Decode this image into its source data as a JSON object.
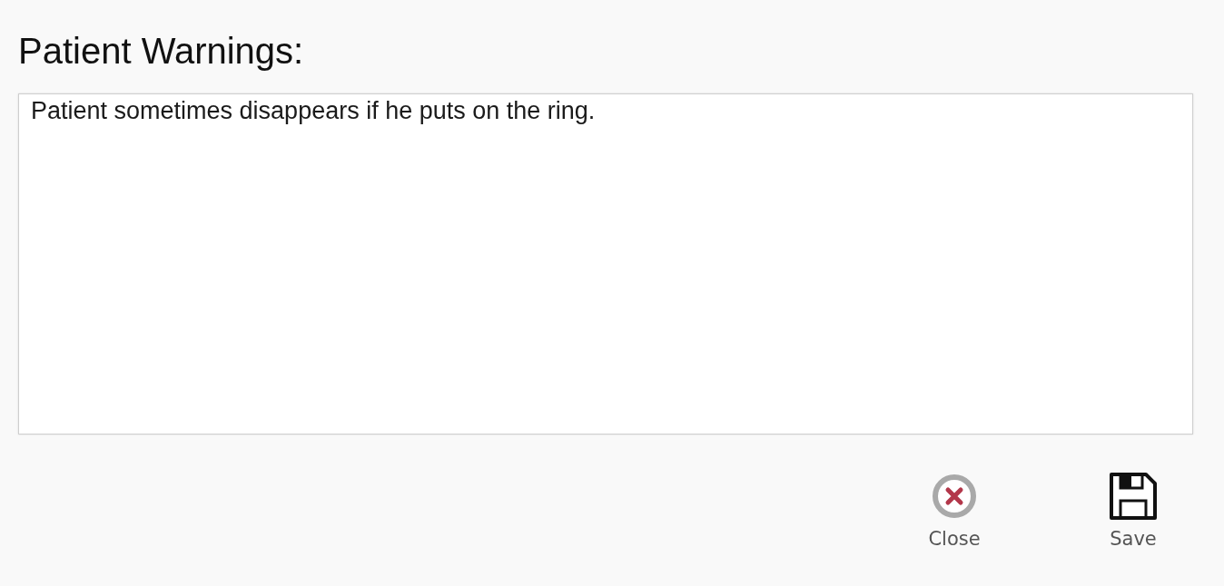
{
  "section": {
    "title": "Patient Warnings:"
  },
  "warnings_field": {
    "value": "Patient sometimes disappears if he puts on the ring."
  },
  "actions": [
    {
      "kind": "close",
      "label": "Close"
    },
    {
      "kind": "save",
      "label": "Save"
    }
  ]
}
